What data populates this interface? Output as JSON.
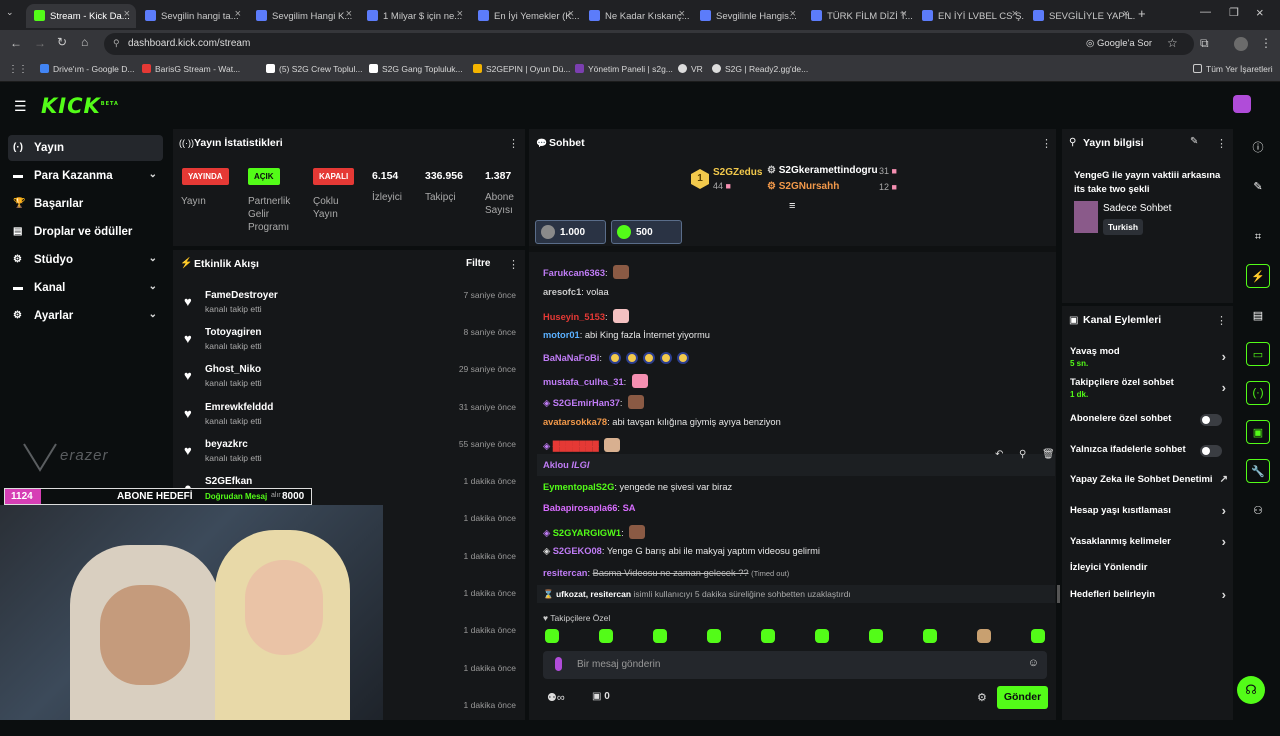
{
  "browser": {
    "tabs": [
      {
        "label": "Stream - Kick Da..."
      },
      {
        "label": "Sevgilin hangi ta..."
      },
      {
        "label": "Sevgilim Hangi K..."
      },
      {
        "label": "1 Milyar $ için ne..."
      },
      {
        "label": "En İyi Yemekler (K..."
      },
      {
        "label": "Ne Kadar Kıskanç..."
      },
      {
        "label": "Sevgilinle Hangis..."
      },
      {
        "label": "TÜRK FİLM DİZİ T..."
      },
      {
        "label": "EN İYİ LVBEL CS Ş..."
      },
      {
        "label": "SEVGİLİYLE YAPIL..."
      }
    ],
    "url": "dashboard.kick.com/stream",
    "google_label": "Google'a Sor",
    "bookmarks": [
      {
        "label": "Drive'ım - Google D...",
        "color": "#4285f4"
      },
      {
        "label": "BarisG Stream - Wat...",
        "color": "#e53935"
      },
      {
        "label": "(5) S2G Crew Toplul...",
        "color": "#ffffff"
      },
      {
        "label": "S2G Gang Topluluk...",
        "color": "#ffffff"
      },
      {
        "label": "S2GEPIN | Oyun Dü...",
        "color": "#f4b400"
      },
      {
        "label": "Yönetim Paneli | s2g...",
        "color": "#7b3fb0"
      },
      {
        "label": "VR",
        "color": "#dddddd"
      },
      {
        "label": "S2G | Ready2.gg'de...",
        "color": "#dddddd"
      }
    ],
    "all_bookmarks": "Tüm Yer İşaretleri"
  },
  "kick": {
    "logo": "KICK",
    "beta": "BETA"
  },
  "sidebar": [
    {
      "label": "Yayın",
      "icon": "(·)",
      "chev": ""
    },
    {
      "label": "Para Kazanma",
      "icon": "▬",
      "chev": "⌄"
    },
    {
      "label": "Başarılar",
      "icon": "🏆",
      "chev": ""
    },
    {
      "label": "Droplar ve ödüller",
      "icon": "▤",
      "chev": ""
    },
    {
      "label": "Stüdyo",
      "icon": "⚙",
      "chev": "⌄"
    },
    {
      "label": "Kanal",
      "icon": "▬",
      "chev": "⌄"
    },
    {
      "label": "Ayarlar",
      "icon": "⚙",
      "chev": "⌄"
    }
  ],
  "stats": {
    "title": "Yayın İstatistikleri",
    "items": [
      {
        "badge": "YAYINDA",
        "badge_color": "#e53935",
        "label": "Yayın"
      },
      {
        "badge": "AÇIK",
        "badge_color": "#53fc18",
        "label": "Partnerlik Gelir Programı"
      },
      {
        "badge": "KAPALI",
        "badge_color": "#e53935",
        "label": "Çoklu Yayın"
      },
      {
        "value": "6.154",
        "label": "İzleyici"
      },
      {
        "value": "336.956",
        "label": "Takipçi"
      },
      {
        "value": "1.387",
        "label": "Abone Sayısı"
      }
    ]
  },
  "activity": {
    "title": "Etkinlik Akışı",
    "filter": "Filtre",
    "rows": [
      {
        "name": "FameDestroyer",
        "sub": "kanalı takip etti",
        "time": "7 saniye önce"
      },
      {
        "name": "Totoyagiren",
        "sub": "kanalı takip etti",
        "time": "8 saniye önce"
      },
      {
        "name": "Ghost_Niko",
        "sub": "kanalı takip etti",
        "time": "29 saniye önce"
      },
      {
        "name": "Emrewkfelddd",
        "sub": "kanalı takip etti",
        "time": "31 saniye önce"
      },
      {
        "name": "beyazkrc",
        "sub": "kanalı takip etti",
        "time": "55 saniye önce"
      },
      {
        "name": "S2GEfkan",
        "sub": "",
        "time": "1 dakika önce"
      },
      {
        "name": "",
        "sub": "",
        "time": "1 dakika önce"
      },
      {
        "name": "",
        "sub": "",
        "time": "1 dakika önce"
      },
      {
        "name": "",
        "sub": "",
        "time": "1 dakika önce"
      },
      {
        "name": "",
        "sub": "",
        "time": "1 dakika önce"
      },
      {
        "name": "",
        "sub": "",
        "time": "1 dakika önce"
      },
      {
        "name": "",
        "sub": "",
        "time": "1 dakika önce"
      }
    ]
  },
  "overlay": {
    "sub_count": "1124",
    "sub_goal_label": "ABONE HEDEFİ",
    "dm_label": "Doğrudan Mesaj",
    "dm_suffix": "alır",
    "goal_value": "8000",
    "erazer": "erazer"
  },
  "chat": {
    "title": "Sohbet",
    "leaderboard": {
      "first": {
        "rank": "1",
        "name": "S2GZedus",
        "count": "44"
      },
      "second": {
        "name": "S2Gkeramettindogru",
        "count": "31"
      },
      "third": {
        "name": "S2GNursahh",
        "count": "12"
      }
    },
    "pins": [
      {
        "value": "1.000"
      },
      {
        "value": "500"
      }
    ],
    "messages": [
      {
        "user": "Farukcan6363",
        "color": "#c07cf6",
        "text": ""
      },
      {
        "user": "aresofc1",
        "color": "#c9c9c9",
        "text": "volaa"
      },
      {
        "user": "Huseyin_5153",
        "color": "#e53935",
        "text": ""
      },
      {
        "user": "motor01",
        "color": "#5ab0ff",
        "text": "abi King fazla İnternet yiyormu"
      },
      {
        "user": "BaNaNaFoBi",
        "color": "#c07cf6",
        "text": ""
      },
      {
        "user": "mustafa_culha_31",
        "color": "#c07cf6",
        "text": ""
      },
      {
        "user": "S2GEmirHan37",
        "color": "#c07cf6",
        "text": ""
      },
      {
        "user": "avatarsokka78",
        "color": "#f2994a",
        "text": "abi tavşan kılığına giymiş ayıya benziyon"
      },
      {
        "user": "Aklou",
        "color": "#c07cf6",
        "text": ""
      },
      {
        "user": "EymentopalS2G",
        "color": "#53fc18",
        "text": "yengede ne şivesi var biraz"
      },
      {
        "user": "Babapirosapla66",
        "color": "#d86cff",
        "text": "SA"
      },
      {
        "user": "S2GYARGIGW1",
        "color": "#53fc18",
        "text": ""
      },
      {
        "user": "S2GEKO08",
        "color": "#c07cf6",
        "text": "Yenge G barış abi ile makyaj yaptım videosu gelirmi"
      },
      {
        "user": "resitercan",
        "color": "#c07cf6",
        "text": "Basma Videosu ne zaman gelecek ??",
        "note": "(Timed out)"
      }
    ],
    "system": {
      "names": "ufkozat, resitercan",
      "text": "isimli kullanıcıyı 5 dakika süreliğine sohbetten uzaklaştırdı"
    },
    "followers_only": "Takipçilere Özel",
    "input_placeholder": "Bir mesaj gönderin",
    "count": "0",
    "send": "Gönder"
  },
  "stream_info": {
    "title": "Yayın bilgisi",
    "stream_title": "YengeG ile yayın vaktiii arkasına its take two şekli",
    "category": "Sadece Sohbet",
    "language": "Turkish"
  },
  "channel_actions": {
    "title": "Kanal Eylemleri",
    "items": [
      {
        "label": "Yavaş mod",
        "sub": "5 sn.",
        "control": "chevron"
      },
      {
        "label": "Takipçilere özel sohbet",
        "sub": "1 dk.",
        "control": "chevron"
      },
      {
        "label": "Abonelere özel sohbet",
        "sub": "",
        "control": "toggle"
      },
      {
        "label": "Yalnızca ifadelerle sohbet",
        "sub": "",
        "control": "toggle"
      },
      {
        "label": "Yapay Zeka ile Sohbet Denetimi",
        "sub": "",
        "control": "external"
      },
      {
        "label": "Hesap yaşı kısıtlaması",
        "sub": "",
        "control": "chevron"
      },
      {
        "label": "Yasaklanmış kelimeler",
        "sub": "",
        "control": "chevron"
      },
      {
        "label": "İzleyici Yönlendir",
        "sub": "",
        "control": "none"
      },
      {
        "label": "Hedefleri belirleyin",
        "sub": "",
        "control": "chevron"
      }
    ]
  },
  "colors": {
    "brand": "#53fc18",
    "live": "#e53935",
    "bg": "#0b0e0f",
    "panel": "#151719"
  }
}
